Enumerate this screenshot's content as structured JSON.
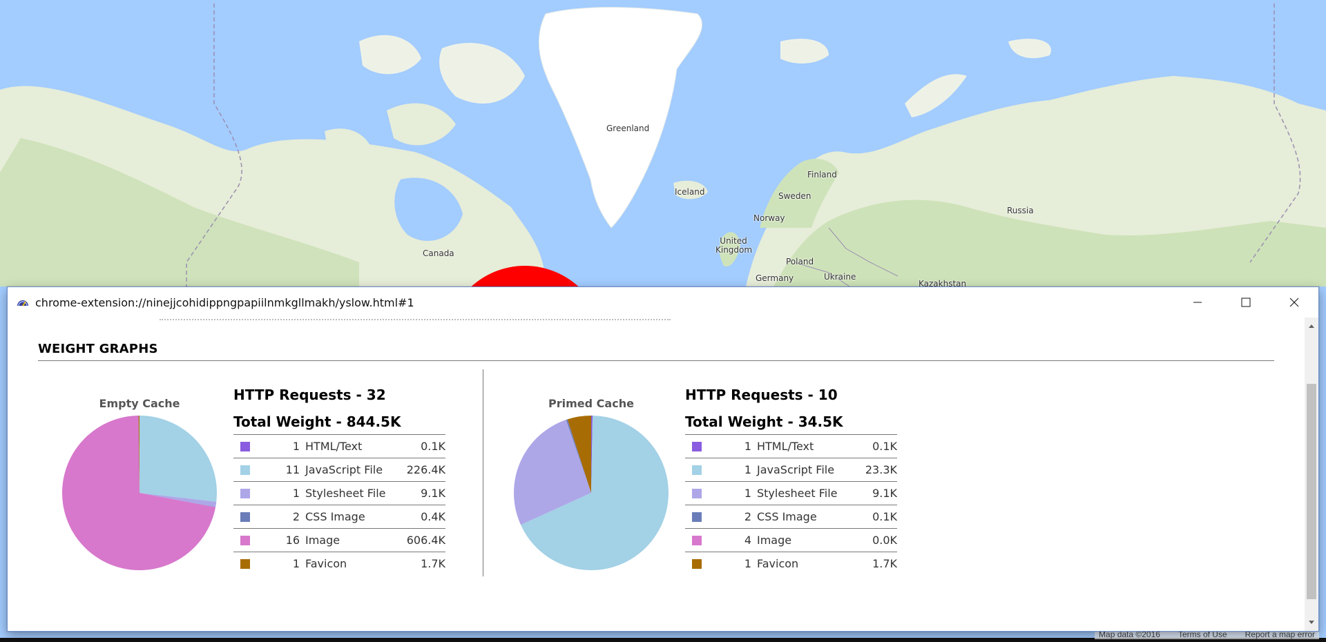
{
  "map": {
    "labels": [
      {
        "key": "greenland",
        "text": "Greenland"
      },
      {
        "key": "iceland",
        "text": "Iceland"
      },
      {
        "key": "finland",
        "text": "Finland"
      },
      {
        "key": "sweden",
        "text": "Sweden"
      },
      {
        "key": "norway",
        "text": "Norway"
      },
      {
        "key": "russia",
        "text": "Russia"
      },
      {
        "key": "canada",
        "text": "Canada"
      },
      {
        "key": "united_kingdom",
        "text": "United Kingdom"
      },
      {
        "key": "poland",
        "text": "Poland"
      },
      {
        "key": "germany",
        "text": "Germany"
      },
      {
        "key": "ukraine",
        "text": "Ukraine"
      },
      {
        "key": "kazakhstan",
        "text": "Kazakhstan"
      }
    ],
    "footer": {
      "map_data": "Map data ©2016",
      "terms": "Terms of Use",
      "report": "Report a map error"
    },
    "colors": {
      "water": "#a3ccff",
      "land": "#e8eedb",
      "land_green": "#c8dfb2",
      "ice": "#ffffff",
      "marker": "#ff0000",
      "border": "#9a8fb0"
    }
  },
  "window": {
    "title": "chrome-extension://ninejjcohidippngpapiilnmkgllmakh/yslow.html#1",
    "app_icon": "yslow-gauge-icon",
    "controls": {
      "minimize": "minimize-icon",
      "maximize": "maximize-icon",
      "close": "close-icon"
    }
  },
  "section_title": "WEIGHT GRAPHS",
  "empty_cache": {
    "caption": "Empty Cache",
    "requests_label": "HTTP Requests - 32",
    "weight_label": "Total Weight - 844.5K",
    "rows": [
      {
        "count": "1",
        "name": "HTML/Text",
        "size": "0.1K",
        "color": "#8a5ce0"
      },
      {
        "count": "11",
        "name": "JavaScript File",
        "size": "226.4K",
        "color": "#a3d1e6"
      },
      {
        "count": "1",
        "name": "Stylesheet File",
        "size": "9.1K",
        "color": "#ada7e8"
      },
      {
        "count": "2",
        "name": "CSS Image",
        "size": "0.4K",
        "color": "#6a7db8"
      },
      {
        "count": "16",
        "name": "Image",
        "size": "606.4K",
        "color": "#d778cc"
      },
      {
        "count": "1",
        "name": "Favicon",
        "size": "1.7K",
        "color": "#a86c05"
      }
    ]
  },
  "primed_cache": {
    "caption": "Primed Cache",
    "requests_label": "HTTP Requests - 10",
    "weight_label": "Total Weight - 34.5K",
    "rows": [
      {
        "count": "1",
        "name": "HTML/Text",
        "size": "0.1K",
        "color": "#8a5ce0"
      },
      {
        "count": "1",
        "name": "JavaScript File",
        "size": "23.3K",
        "color": "#a3d1e6"
      },
      {
        "count": "1",
        "name": "Stylesheet File",
        "size": "9.1K",
        "color": "#ada7e8"
      },
      {
        "count": "2",
        "name": "CSS Image",
        "size": "0.1K",
        "color": "#6a7db8"
      },
      {
        "count": "4",
        "name": "Image",
        "size": "0.0K",
        "color": "#d778cc"
      },
      {
        "count": "1",
        "name": "Favicon",
        "size": "1.7K",
        "color": "#a86c05"
      }
    ]
  },
  "chart_data": [
    {
      "type": "pie",
      "title": "Empty Cache",
      "categories": [
        "HTML/Text",
        "JavaScript File",
        "Stylesheet File",
        "CSS Image",
        "Image",
        "Favicon"
      ],
      "values": [
        0.1,
        226.4,
        9.1,
        0.4,
        606.4,
        1.7
      ],
      "colors": [
        "#8a5ce0",
        "#a3d1e6",
        "#ada7e8",
        "#6a7db8",
        "#d778cc",
        "#a86c05"
      ]
    },
    {
      "type": "pie",
      "title": "Primed Cache",
      "categories": [
        "HTML/Text",
        "JavaScript File",
        "Stylesheet File",
        "CSS Image",
        "Image",
        "Favicon"
      ],
      "values": [
        0.1,
        23.3,
        9.1,
        0.1,
        0.0,
        1.7
      ],
      "colors": [
        "#8a5ce0",
        "#a3d1e6",
        "#ada7e8",
        "#6a7db8",
        "#d778cc",
        "#a86c05"
      ]
    }
  ]
}
